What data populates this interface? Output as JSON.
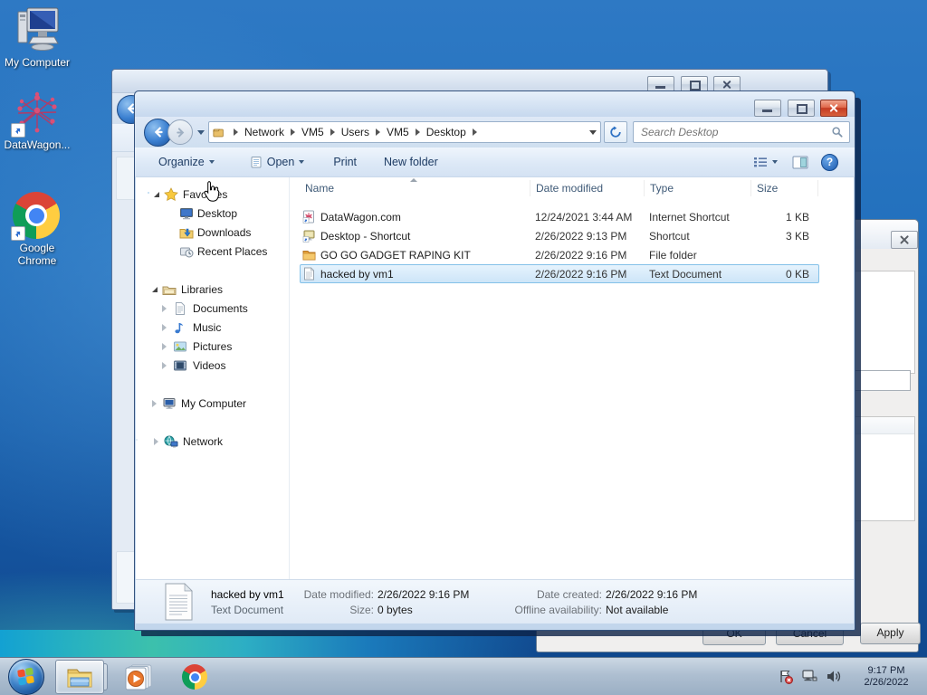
{
  "desktop": {
    "icons": [
      {
        "label": "My Computer"
      },
      {
        "label": "DataWagon..."
      },
      {
        "label": "Google Chrome"
      }
    ]
  },
  "explorer": {
    "breadcrumb": {
      "items": [
        "Network",
        "VM5",
        "Users",
        "VM5",
        "Desktop"
      ]
    },
    "search_placeholder": "Search Desktop",
    "toolbar": {
      "organize": "Organize",
      "open": "Open",
      "print": "Print",
      "new_folder": "New folder"
    },
    "sidebar": {
      "favorites": {
        "label": "Favorites",
        "items": [
          "Desktop",
          "Downloads",
          "Recent Places"
        ]
      },
      "libraries": {
        "label": "Libraries",
        "items": [
          "Documents",
          "Music",
          "Pictures",
          "Videos"
        ]
      },
      "computer": {
        "label": "My Computer"
      },
      "network": {
        "label": "Network"
      }
    },
    "columns": {
      "name": "Name",
      "date": "Date modified",
      "type": "Type",
      "size": "Size"
    },
    "files": [
      {
        "name": "DataWagon.com",
        "date": "12/24/2021 3:44 AM",
        "type": "Internet Shortcut",
        "size": "1 KB"
      },
      {
        "name": "Desktop - Shortcut",
        "date": "2/26/2022 9:13 PM",
        "type": "Shortcut",
        "size": "3 KB"
      },
      {
        "name": "GO GO GADGET RAPING KIT",
        "date": "2/26/2022 9:16 PM",
        "type": "File folder",
        "size": ""
      },
      {
        "name": "hacked by vm1",
        "date": "2/26/2022 9:16 PM",
        "type": "Text Document",
        "size": "0 KB"
      }
    ],
    "details": {
      "name": "hacked by vm1",
      "type": "Text Document",
      "date_modified_label": "Date modified:",
      "date_modified": "2/26/2022 9:16 PM",
      "size_label": "Size:",
      "size": "0 bytes",
      "date_created_label": "Date created:",
      "date_created": "2/26/2022 9:16 PM",
      "offline_label": "Offline availability:",
      "offline": "Not available"
    }
  },
  "dialog": {
    "ok": "OK",
    "cancel": "Cancel",
    "apply": "Apply"
  },
  "taskbar": {
    "time": "9:17 PM",
    "date": "2/26/2022"
  },
  "icons": {
    "help_glyph": "?"
  }
}
